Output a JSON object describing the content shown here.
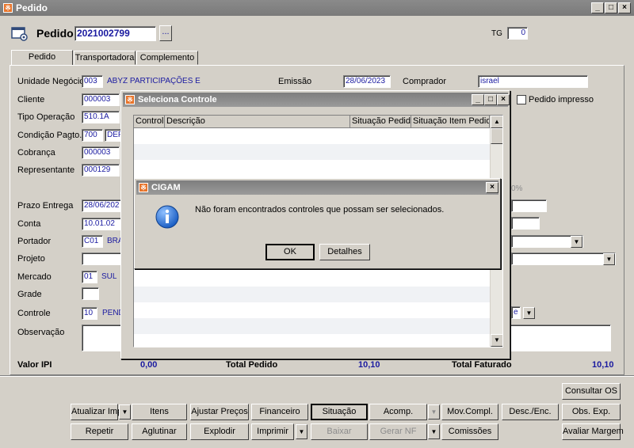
{
  "window": {
    "title": "Pedido"
  },
  "header": {
    "pedido_label": "Pedido",
    "pedido_value": "2021002799",
    "lookup_button": "...",
    "tg_label": "TG",
    "tg_value": "0"
  },
  "tabs": [
    "Pedido",
    "Transportadora",
    "Complemento"
  ],
  "form": {
    "unidade_label": "Unidade Negócio",
    "unidade_code": "003",
    "unidade_name": "ABYZ PARTICIPAÇÕES E",
    "emissao_label": "Emissão",
    "emissao_value": "28/06/2023",
    "comprador_label": "Comprador",
    "comprador_value": "israel",
    "cliente_label": "Cliente",
    "cliente_code": "000003",
    "pedido_impresso_label": "Pedido impresso",
    "tipo_operacao_label": "Tipo Operação",
    "tipo_operacao_code": "510.1A",
    "condicao_label": "Condição Pagto.",
    "condicao_code": "700",
    "condicao_name": "DEP",
    "cobranca_label": "Cobrança",
    "cobranca_code": "000003",
    "representante_label": "Representante",
    "representante_code": "000129",
    "percent_value": "0%",
    "prazo_label": "Prazo Entrega",
    "prazo_value": "28/06/202",
    "conta_label": "Conta",
    "conta_value": "10.01.02",
    "portador_label": "Portador",
    "portador_code": "C01",
    "portador_name": "BRA",
    "projeto_label": "Projeto",
    "mercado_label": "Mercado",
    "mercado_code": "01",
    "mercado_name": "SUL",
    "grade_label": "Grade",
    "controle_label": "Controle",
    "controle_code": "10",
    "controle_name": "PEND",
    "controle_right_fragment": "e",
    "observacao_label": "Observação"
  },
  "totals": {
    "valor_ipi_label": "Valor IPI",
    "valor_ipi_value": "0,00",
    "total_pedido_label": "Total Pedido",
    "total_pedido_value": "10,10",
    "total_faturado_label": "Total Faturado",
    "total_faturado_value": "10,10"
  },
  "buttons": {
    "consultar_os": "Consultar OS",
    "atualizar_imp": "Atualizar Imp",
    "itens": "Itens",
    "ajustar_precos": "Ajustar Preços",
    "financeiro": "Financeiro",
    "situacao": "Situação",
    "acomp": "Acomp.",
    "mov_compl": "Mov.Compl.",
    "desc_enc": "Desc./Enc.",
    "obs_exp": "Obs. Exp.",
    "repetir": "Repetir",
    "aglutinar": "Aglutinar",
    "explodir": "Explodir",
    "imprimir": "Imprimir",
    "baixar": "Baixar",
    "gerar_nf": "Gerar NF",
    "comissoes": "Comissões",
    "avaliar_margem": "Avaliar Margem"
  },
  "seleciona_dialog": {
    "title": "Seleciona Controle",
    "columns": [
      "Controle",
      "Descrição",
      "Situação Pedido",
      "Situação Item Pedido"
    ]
  },
  "message_dialog": {
    "title": "CIGAM",
    "message": "Não foram encontrados controles que possam ser selecionados.",
    "ok_label": "OK",
    "detalhes_label": "Detalhes"
  },
  "colors": {
    "field_text": "#1a1aa0",
    "title_bar": "#808080",
    "info_icon": "#1c5fc4"
  },
  "icons": [
    "app-icon",
    "pedido-form-icon",
    "info-icon",
    "dropdown-arrow-icon",
    "scroll-up-icon",
    "scroll-down-icon"
  ]
}
